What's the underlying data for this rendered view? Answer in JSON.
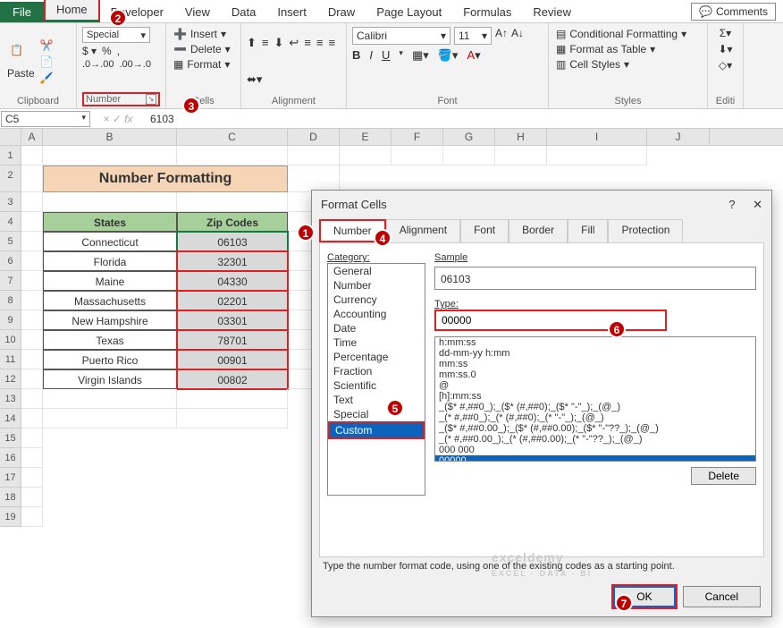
{
  "tabs": {
    "file": "File",
    "home": "Home",
    "developer": "Developer",
    "view": "View",
    "data": "Data",
    "insert": "Insert",
    "draw": "Draw",
    "page_layout": "Page Layout",
    "formulas": "Formulas",
    "review": "Review",
    "comments": "Comments"
  },
  "ribbon": {
    "clipboard": {
      "label": "Clipboard",
      "paste": "Paste"
    },
    "number": {
      "label": "Number",
      "format": "Special",
      "insert": "Insert",
      "delete": "Delete",
      "fmt": "Format"
    },
    "cells": {
      "label": "Cells"
    },
    "alignment": {
      "label": "Alignment"
    },
    "font": {
      "label": "Font",
      "name": "Calibri",
      "size": "11"
    },
    "styles": {
      "label": "Styles",
      "cond": "Conditional Formatting",
      "table": "Format as Table",
      "cell": "Cell Styles"
    },
    "editing": {
      "label": "Editi"
    }
  },
  "namebox": "C5",
  "formula_bar": "6103",
  "columns": [
    "A",
    "B",
    "C",
    "D",
    "E",
    "F",
    "G",
    "H",
    "I",
    "J"
  ],
  "sheet": {
    "title": "Number Formatting",
    "hdr_states": "States",
    "hdr_zip": "Zip Codes",
    "rows": [
      {
        "state": "Connecticut",
        "zip": "06103"
      },
      {
        "state": "Florida",
        "zip": "32301"
      },
      {
        "state": "Maine",
        "zip": "04330"
      },
      {
        "state": "Massachusetts",
        "zip": "02201"
      },
      {
        "state": "New Hampshire",
        "zip": "03301"
      },
      {
        "state": "Texas",
        "zip": "78701"
      },
      {
        "state": "Puerto Rico",
        "zip": "00901"
      },
      {
        "state": "Virgin Islands",
        "zip": "00802"
      }
    ]
  },
  "dialog": {
    "title": "Format Cells",
    "tabs": {
      "number": "Number",
      "alignment": "Alignment",
      "font": "Font",
      "border": "Border",
      "fill": "Fill",
      "protection": "Protection"
    },
    "category_label": "Category:",
    "categories": [
      "General",
      "Number",
      "Currency",
      "Accounting",
      "Date",
      "Time",
      "Percentage",
      "Fraction",
      "Scientific",
      "Text",
      "Special",
      "Custom"
    ],
    "sample_label": "Sample",
    "sample_value": "06103",
    "type_label": "Type:",
    "type_value": "00000",
    "formats": [
      "h:mm:ss",
      "dd-mm-yy h:mm",
      "mm:ss",
      "mm:ss.0",
      "@",
      "[h]:mm:ss",
      "_($* #,##0_);_($* (#,##0);_($* \"-\"_);_(@_)",
      "_(* #,##0_);_(* (#,##0);_(* \"-\"_);_(@_)",
      "_($* #,##0.00_);_($* (#,##0.00);_($* \"-\"??_);_(@_)",
      "_(* #,##0.00_);_(* (#,##0.00);_(* \"-\"??_);_(@_)",
      "000 000",
      "00000"
    ],
    "delete": "Delete",
    "hint": "Type the number format code, using one of the existing codes as a starting point.",
    "ok": "OK",
    "cancel": "Cancel"
  },
  "callouts": {
    "1": "1",
    "2": "2",
    "3": "3",
    "4": "4",
    "5": "5",
    "6": "6",
    "7": "7"
  },
  "watermark": "exceldemy"
}
